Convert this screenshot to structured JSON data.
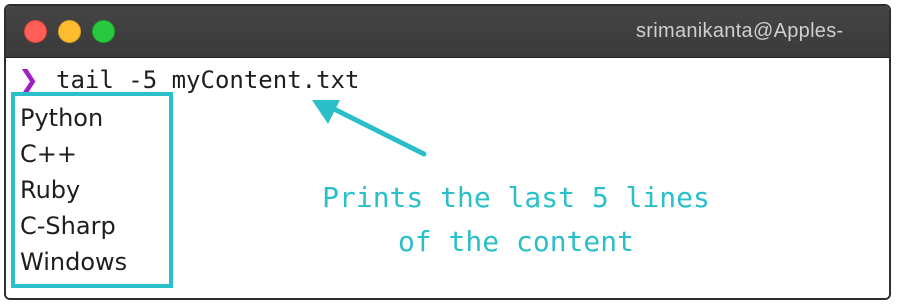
{
  "window": {
    "title": "srimanikanta@Apples-"
  },
  "terminal": {
    "prompt_symbol": "❯",
    "command": "tail -5 myContent.txt",
    "output": [
      "Python",
      "C++",
      "Ruby",
      "C-Sharp",
      "Windows"
    ]
  },
  "annotation": {
    "line1": "Prints the last 5 lines",
    "line2": "of the content"
  },
  "colors": {
    "accent": "#2bbfc9",
    "prompt": "#a020c8",
    "close": "#ff5f57",
    "minimize": "#febc2e",
    "maximize": "#28c840"
  },
  "icons": {
    "close": "close-dot-icon",
    "minimize": "minimize-dot-icon",
    "maximize": "maximize-dot-icon",
    "arrow": "arrow-icon"
  }
}
